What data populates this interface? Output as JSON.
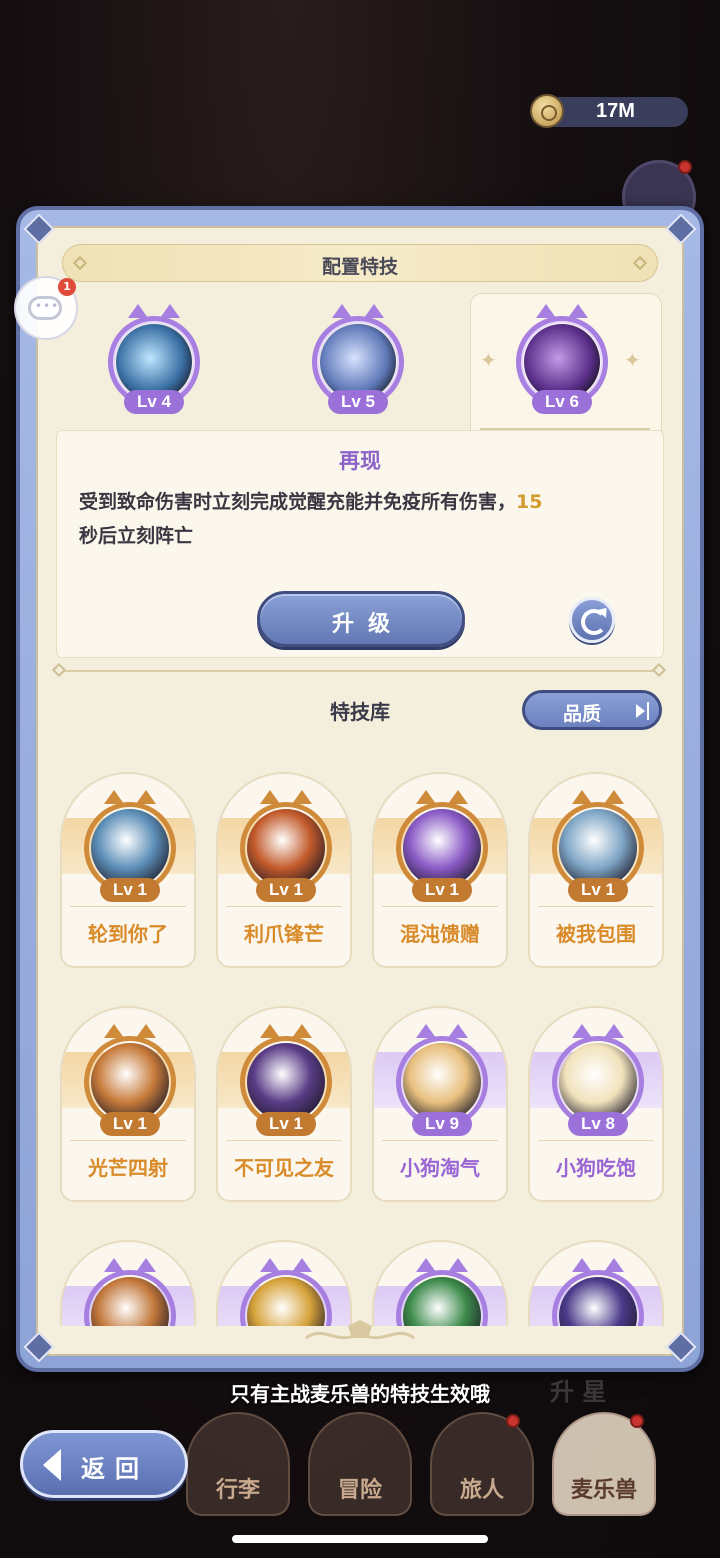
{
  "currency": {
    "amount": "17M",
    "icon": "coin-icon"
  },
  "panel": {
    "title": "配置特技"
  },
  "chat": {
    "badge": "1"
  },
  "equipped": [
    {
      "level": "Lv 4",
      "color": "#7ec3f2"
    },
    {
      "level": "Lv 5",
      "color": "#8fa9e0"
    },
    {
      "level": "Lv 6",
      "color": "#9b5ad6"
    }
  ],
  "selected_skill": {
    "name": "再现",
    "desc_part1": "受到致命伤害时立刻完成觉醒充能并免疫所有伤害，",
    "desc_highlight": "15",
    "desc_part2": "秒后立刻阵亡",
    "upgrade_label": "升级"
  },
  "library": {
    "title": "特技库",
    "filter_label": "品质",
    "items": [
      {
        "name": "轮到你了",
        "level": "Lv 1",
        "tier": "orange",
        "art": "#5c8fb8"
      },
      {
        "name": "利爪锋芒",
        "level": "Lv 1",
        "tier": "orange",
        "art": "#c25a2a"
      },
      {
        "name": "混沌馈赠",
        "level": "Lv 1",
        "tier": "orange",
        "art": "#8a5ac6"
      },
      {
        "name": "被我包围",
        "level": "Lv 1",
        "tier": "orange",
        "art": "#7fa6c6"
      },
      {
        "name": "光芒四射",
        "level": "Lv 1",
        "tier": "orange",
        "art": "#c77b3a"
      },
      {
        "name": "不可见之友",
        "level": "Lv 1",
        "tier": "orange",
        "art": "#5a3c86"
      },
      {
        "name": "小狗淘气",
        "level": "Lv 9",
        "tier": "purple",
        "art": "#e8c07e"
      },
      {
        "name": "小狗吃饱",
        "level": "Lv 8",
        "tier": "purple",
        "art": "#f2e2bc"
      },
      {
        "name": "",
        "level": "",
        "tier": "purple",
        "art": "#c2773a"
      },
      {
        "name": "",
        "level": "",
        "tier": "purple",
        "art": "#d6a23a"
      },
      {
        "name": "",
        "level": "",
        "tier": "purple",
        "art": "#3c8a4a"
      },
      {
        "name": "",
        "level": "",
        "tier": "purple",
        "art": "#4a3a8a"
      }
    ]
  },
  "hint": "只有主战麦乐兽的特技生效哦",
  "bottom_nav": {
    "back_label": "返回",
    "items": [
      "行李",
      "冒险",
      "旅人",
      "麦乐兽"
    ],
    "ghost_label": "升 星"
  }
}
